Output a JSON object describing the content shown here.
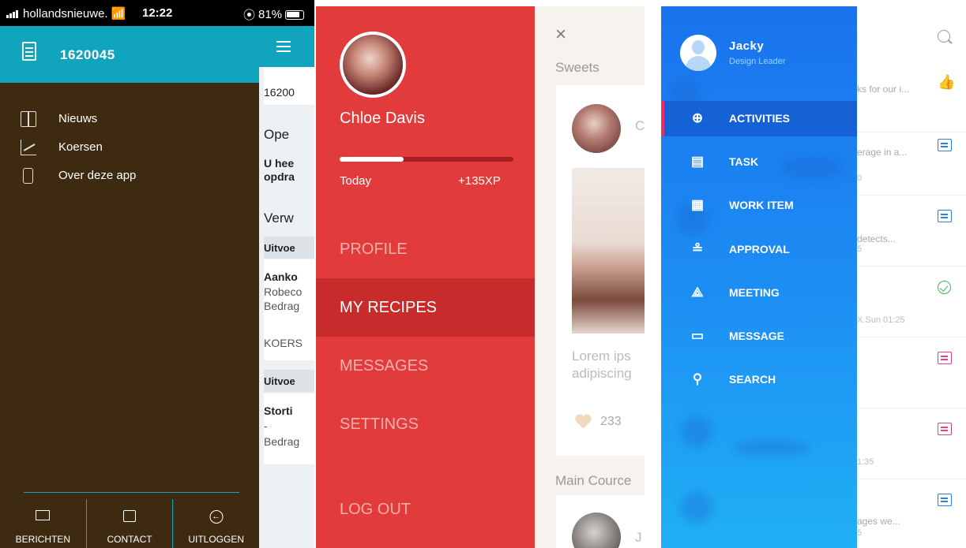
{
  "panel1": {
    "status": {
      "carrier": "hollandsnieuwe.",
      "time": "12:22",
      "battery": "81%"
    },
    "account_number": "1620045",
    "menu": [
      {
        "label": "Nieuws",
        "icon": "book-icon"
      },
      {
        "label": "Koersen",
        "icon": "chart-icon"
      },
      {
        "label": "Over deze app",
        "icon": "phone-icon"
      }
    ],
    "footer": [
      {
        "label": "BERICHTEN",
        "icon": "envelope-icon"
      },
      {
        "label": "CONTACT",
        "icon": "chat-icon"
      },
      {
        "label": "UITLOGGEN",
        "icon": "logout-icon"
      }
    ],
    "behind": {
      "account": "16200",
      "heading1": "Ope",
      "bold1": "U hee",
      "bold2": "opdra",
      "heading2": "Verw",
      "bar1": "Uitvoe",
      "item1_title": "Aanko",
      "item1_line1": "Robeco",
      "item1_line2": "Bedrag",
      "item1_line3": "KOERS",
      "bar2": "Uitvoe",
      "item2_title": "Storti",
      "item2_line1": "-",
      "item2_line2": "Bedrag"
    },
    "colors": {
      "header": "#11a4bd",
      "drawer": "#3d2a10"
    }
  },
  "panel2": {
    "user_name": "Chloe Davis",
    "progress_fraction": 0.37,
    "today_label": "Today",
    "xp_label": "+135XP",
    "menu": [
      {
        "label": "PROFILE",
        "state": "dim"
      },
      {
        "label": "MY RECIPES",
        "state": "active"
      },
      {
        "label": "MESSAGES",
        "state": "dim"
      },
      {
        "label": "SETTINGS",
        "state": "dim"
      },
      {
        "label": "LOG OUT",
        "state": "dim"
      }
    ],
    "content": {
      "close": "×",
      "section1": "Sweets",
      "card_initial": "C",
      "card_text_line1": "Lorem ips",
      "card_text_line2": "adipiscing",
      "likes": "233",
      "section2": "Main Cource",
      "card2_initial": "J"
    },
    "colors": {
      "drawer": "#e23b3b",
      "active": "#c72b2c"
    }
  },
  "panel3": {
    "user_name": "Jacky",
    "user_role": "Design Leader",
    "menu": [
      {
        "label": "ACTIVITIES",
        "icon": "compass-icon",
        "glyph": "⊕",
        "active": true
      },
      {
        "label": "TASK",
        "icon": "task-icon",
        "glyph": "▤",
        "active": false
      },
      {
        "label": "WORK ITEM",
        "icon": "work-item-icon",
        "glyph": "▦",
        "active": false
      },
      {
        "label": "APPROVAL",
        "icon": "approval-stamp-icon",
        "glyph": "≗",
        "active": false
      },
      {
        "label": "MEETING",
        "icon": "meeting-icon",
        "glyph": "⟁",
        "active": false
      },
      {
        "label": "MESSAGE",
        "icon": "message-icon",
        "glyph": "▭",
        "active": false
      },
      {
        "label": "SEARCH",
        "icon": "search-icon",
        "glyph": "⚲",
        "active": false
      }
    ],
    "list": [
      {
        "title": "ks for our i...",
        "sub": "",
        "icon": "thumbs-up-icon"
      },
      {
        "title": "erage in a...",
        "sub": "0",
        "icon": "chat-bubble-icon"
      },
      {
        "title": "detects...",
        "sub": "5",
        "icon": "chat-bubble-icon"
      },
      {
        "title": "",
        "sub": "X.Sun 01:25",
        "icon": "check-circle-icon"
      },
      {
        "title": "",
        "sub": "",
        "icon": "calendar-icon"
      },
      {
        "title": "",
        "sub": "1:35",
        "icon": "calendar-icon"
      },
      {
        "title": "ages we...",
        "sub": "5",
        "icon": "chat-bubble-icon"
      }
    ],
    "colors": {
      "drawer": "#1c8cf3",
      "active": "#1561d6",
      "accent": "#e8306d"
    }
  }
}
